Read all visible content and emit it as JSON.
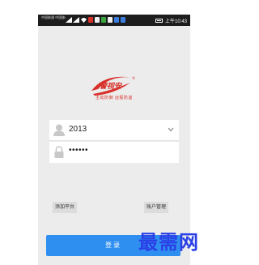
{
  "status_bar": {
    "carrier_line1": "中国联通 中国移动",
    "carrier_line2": "",
    "time": "上午10:43"
  },
  "brand": {
    "name": "警视安",
    "registered": "®",
    "slogan": "主动防御 远程防盗"
  },
  "login_form": {
    "username": "2013",
    "password_mask": "••••••"
  },
  "buttons": {
    "add_platform": "添加平台",
    "account_manage": "账户管理",
    "login": "登录"
  },
  "watermark": "最需网",
  "colors": {
    "brand_red": "#d8312b",
    "login_blue": "#2f8ff0",
    "watermark_blue": "#2a40e6",
    "background": "#ececec"
  },
  "icons": {
    "user": "user-icon",
    "lock": "lock-icon",
    "dropdown": "chevron-down-icon"
  }
}
